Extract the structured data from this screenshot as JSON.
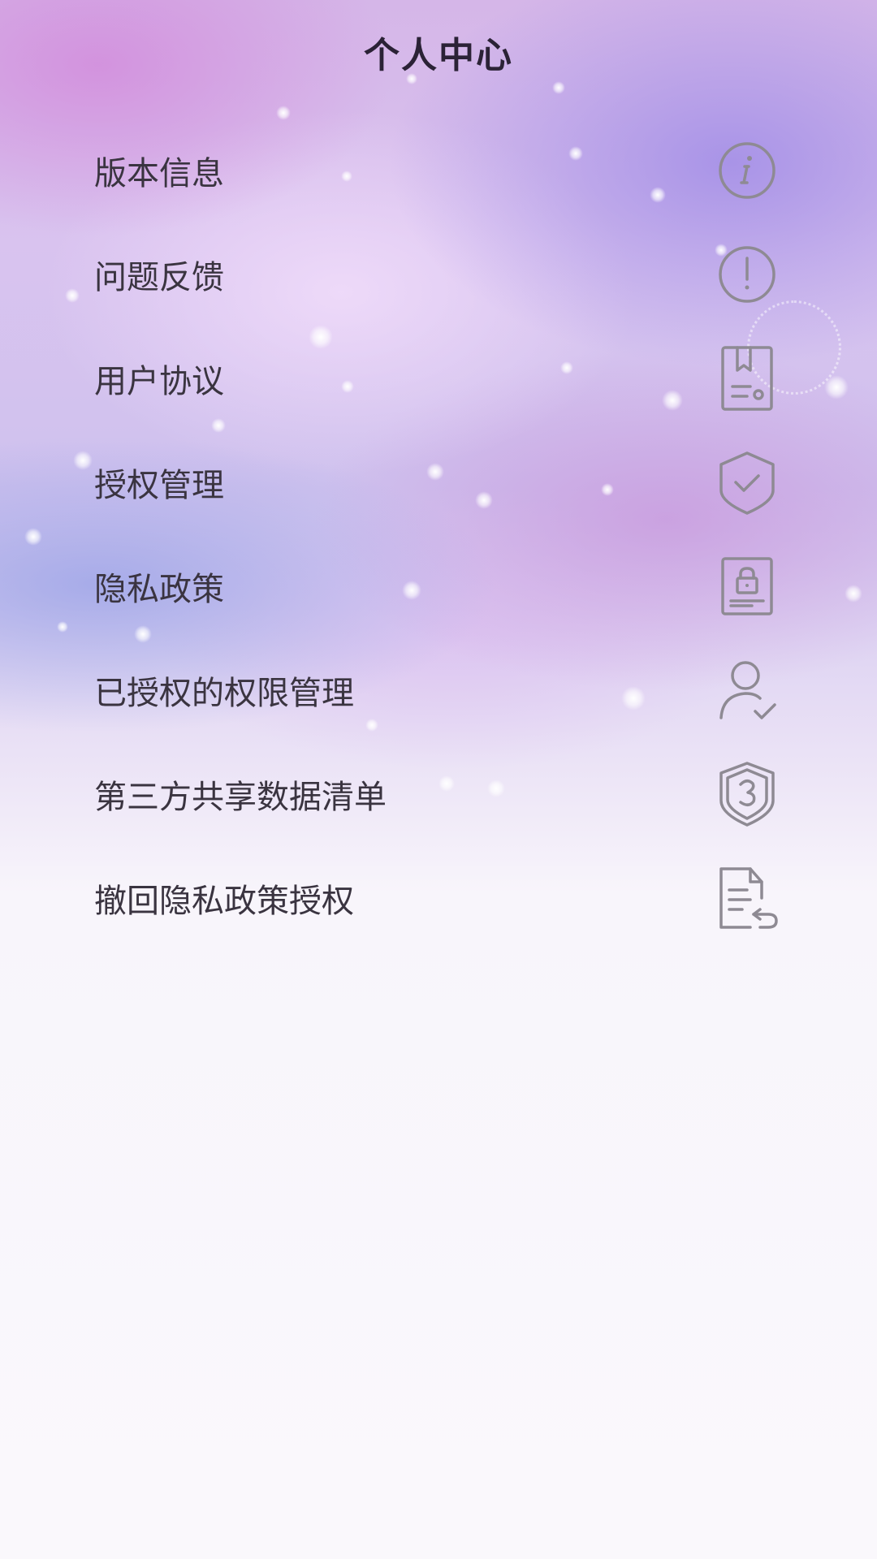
{
  "header": {
    "title": "个人中心"
  },
  "menu": {
    "items": [
      {
        "label": "版本信息",
        "icon": "info-icon"
      },
      {
        "label": "问题反馈",
        "icon": "exclamation-icon"
      },
      {
        "label": "用户协议",
        "icon": "bookmark-document-icon"
      },
      {
        "label": "授权管理",
        "icon": "shield-check-icon"
      },
      {
        "label": "隐私政策",
        "icon": "lock-document-icon"
      },
      {
        "label": "已授权的权限管理",
        "icon": "user-check-icon"
      },
      {
        "label": "第三方共享数据清单",
        "icon": "shield-three-icon"
      },
      {
        "label": "撤回隐私政策授权",
        "icon": "document-return-icon"
      }
    ]
  },
  "colors": {
    "icon": "#8e8a93",
    "text": "#3a3440",
    "title": "#2b2236"
  }
}
